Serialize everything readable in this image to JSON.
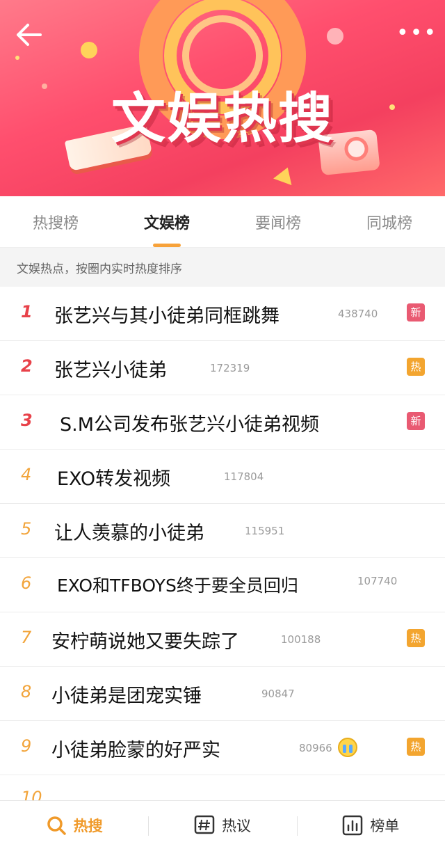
{
  "banner": {
    "title": "文娱热搜",
    "back_icon": "arrow-left-icon",
    "more_label": "•••"
  },
  "tabs": [
    {
      "label": "热搜榜",
      "active": false
    },
    {
      "label": "文娱榜",
      "active": true
    },
    {
      "label": "要闻榜",
      "active": false
    },
    {
      "label": "同城榜",
      "active": false
    }
  ],
  "subtitle": "文娱热点，按圈内实时热度排序",
  "list": [
    {
      "rank": "1",
      "title": "张艺兴与其小徒弟同框跳舞",
      "count": "438740",
      "badge": "新",
      "badge_type": "new"
    },
    {
      "rank": "2",
      "title": "张艺兴小徒弟",
      "count": "172319",
      "badge": "热",
      "badge_type": "hot"
    },
    {
      "rank": "3",
      "title": "S.M公司发布张艺兴小徒弟视频",
      "count": "",
      "badge": "新",
      "badge_type": "new"
    },
    {
      "rank": "4",
      "title": "EXO转发视频",
      "count": "117804",
      "badge": "",
      "badge_type": ""
    },
    {
      "rank": "5",
      "title": "让人羡慕的小徒弟",
      "count": "115951",
      "badge": "",
      "badge_type": ""
    },
    {
      "rank": "6",
      "title": "EXO和TFBOYS终于要全员回归",
      "count": "107740",
      "badge": "",
      "badge_type": ""
    },
    {
      "rank": "7",
      "title": "安柠萌说她又要失踪了",
      "count": "100188",
      "badge": "热",
      "badge_type": "hot"
    },
    {
      "rank": "8",
      "title": "小徒弟是团宠实锤",
      "count": "90847",
      "badge": "",
      "badge_type": ""
    },
    {
      "rank": "9",
      "title": "小徒弟脸蒙的好严实",
      "count": "80966",
      "badge": "热",
      "badge_type": "hot"
    },
    {
      "rank": "10",
      "title": "",
      "count": "",
      "badge": "",
      "badge_type": ""
    }
  ],
  "bottom_nav": [
    {
      "label": "热搜",
      "icon": "search-icon",
      "active": true
    },
    {
      "label": "热议",
      "icon": "hashtag-icon",
      "active": false
    },
    {
      "label": "榜单",
      "icon": "chart-icon",
      "active": false
    }
  ],
  "colors": {
    "accent": "#f7a23a",
    "rank_top": "#e8424a",
    "badge_new": "#e95a72",
    "badge_hot": "#f3a52f"
  }
}
